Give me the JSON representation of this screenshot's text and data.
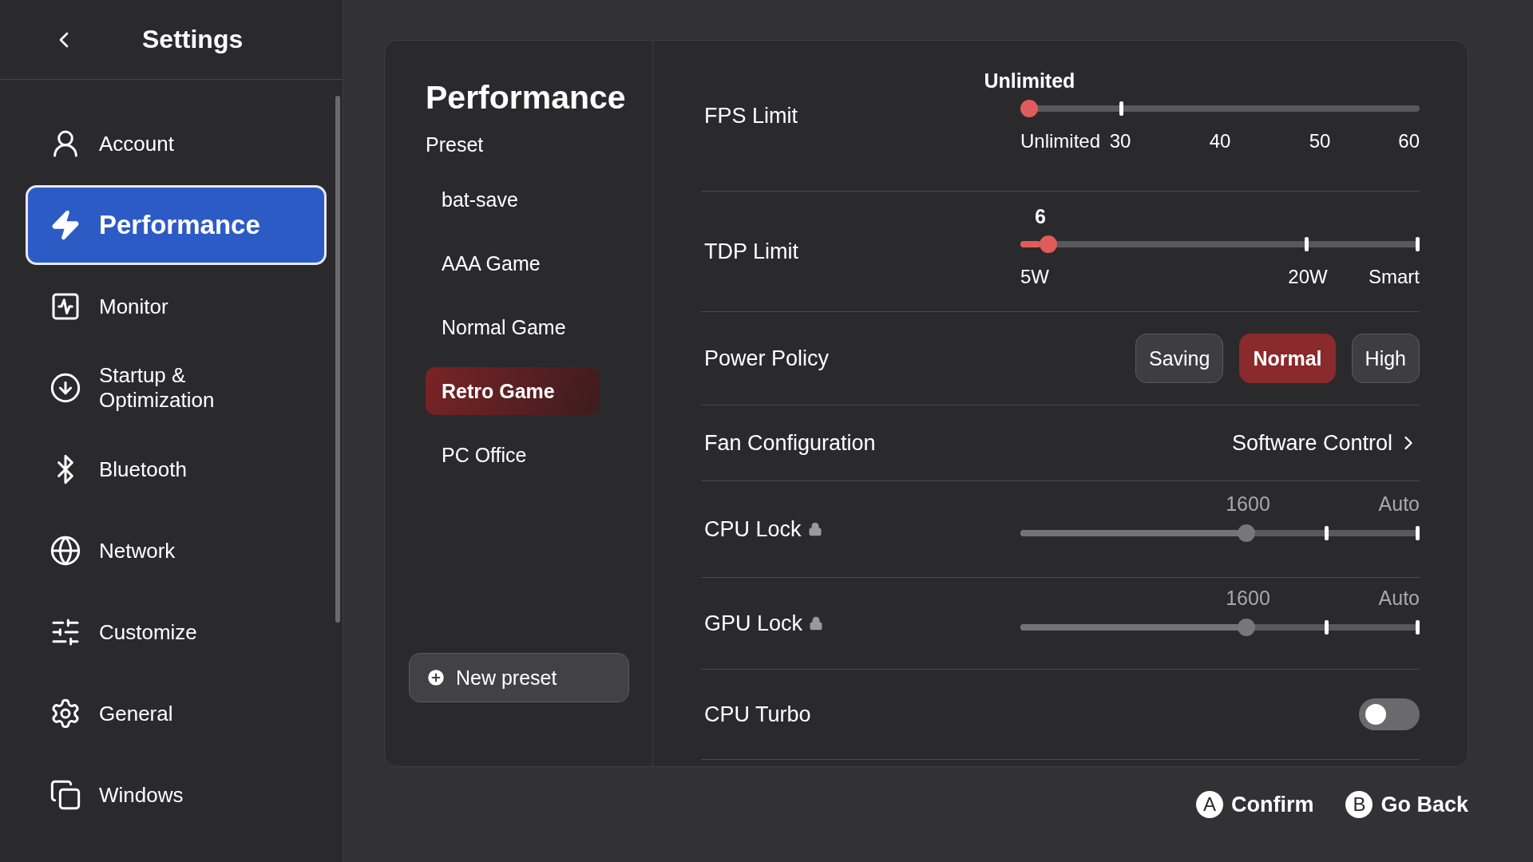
{
  "sidebar": {
    "title": "Settings",
    "items": [
      {
        "label": "Account",
        "selected": false
      },
      {
        "label": "Performance",
        "selected": true
      },
      {
        "label": "Monitor",
        "selected": false
      },
      {
        "label": "Startup & Optimization",
        "selected": false
      },
      {
        "label": "Bluetooth",
        "selected": false
      },
      {
        "label": "Network",
        "selected": false
      },
      {
        "label": "Customize",
        "selected": false
      },
      {
        "label": "General",
        "selected": false
      },
      {
        "label": "Windows",
        "selected": false
      }
    ]
  },
  "panel": {
    "title": "Performance",
    "preset_heading": "Preset",
    "presets": [
      {
        "label": "bat-save",
        "selected": false
      },
      {
        "label": "AAA Game",
        "selected": false
      },
      {
        "label": "Normal Game",
        "selected": false
      },
      {
        "label": "Retro Game",
        "selected": true
      },
      {
        "label": "PC Office",
        "selected": false
      }
    ],
    "new_preset": "New preset"
  },
  "settings": [
    {
      "kind": "slider",
      "label": "FPS Limit",
      "locked": false,
      "value": "Unlimited",
      "level": 0,
      "scale": [
        "Unlimited",
        "30",
        "40",
        "50",
        "60"
      ]
    },
    {
      "kind": "slider",
      "label": "TDP Limit",
      "locked": false,
      "value": "6",
      "level": 0.05,
      "scale": [
        "5W",
        "20W",
        "Smart"
      ]
    },
    {
      "kind": "choice",
      "label": "Power Policy",
      "options": [
        {
          "label": "Saving",
          "selected": false
        },
        {
          "label": "Normal",
          "selected": true
        },
        {
          "label": "High",
          "selected": false
        }
      ]
    },
    {
      "kind": "link",
      "label": "Fan Configuration",
      "value": "Software Control"
    },
    {
      "kind": "slider",
      "label": "CPU Lock",
      "locked": true,
      "value": "1600",
      "level": 0.57,
      "end_label": "Auto"
    },
    {
      "kind": "slider",
      "label": "GPU Lock",
      "locked": true,
      "value": "1600",
      "level": 0.57,
      "end_label": "Auto"
    },
    {
      "kind": "toggle",
      "label": "CPU Turbo",
      "on": false
    }
  ],
  "footer": [
    {
      "key": "A",
      "label": "Confirm"
    },
    {
      "key": "B",
      "label": "Go Back"
    }
  ]
}
